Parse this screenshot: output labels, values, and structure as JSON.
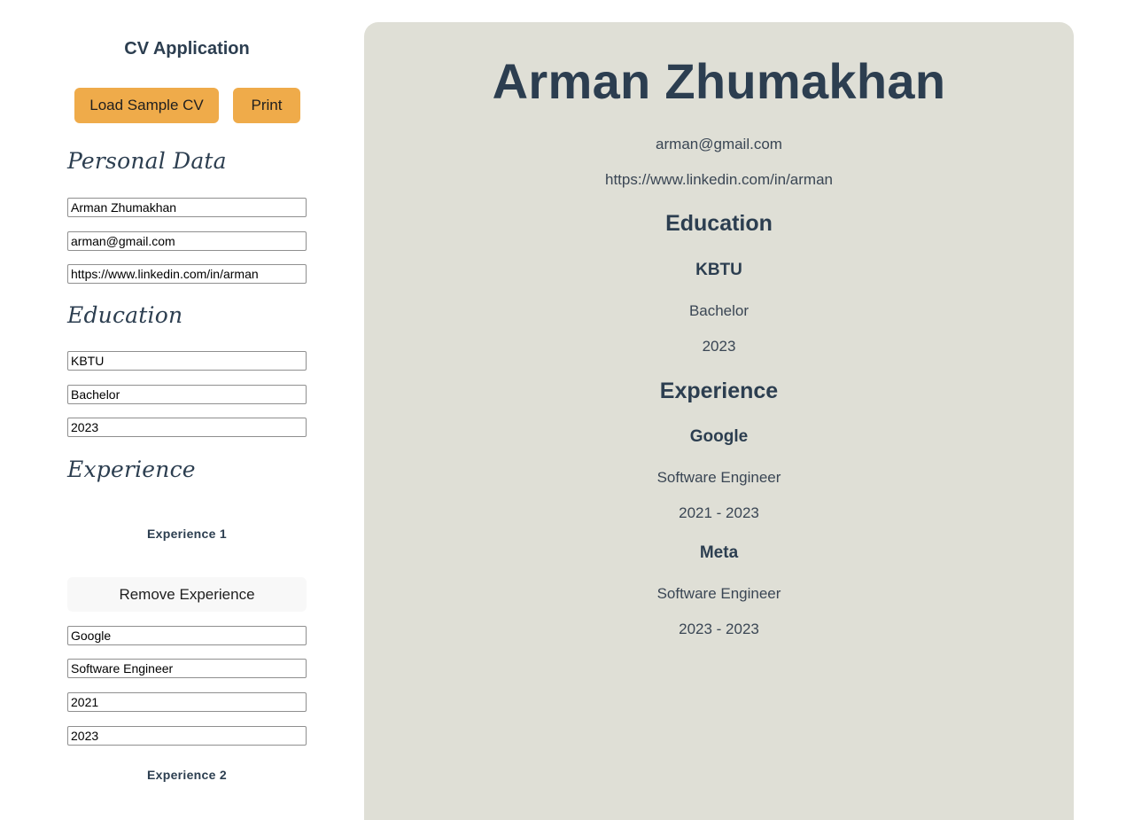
{
  "app": {
    "title": "CV Application",
    "load_sample_label": "Load Sample CV",
    "print_label": "Print"
  },
  "colors": {
    "accent_button": "#efab4a",
    "preview_background": "#dfdfd6",
    "text_dark": "#2c3e50"
  },
  "editor": {
    "personal": {
      "heading": "Personal Data",
      "name": "Arman Zhumakhan",
      "email": "arman@gmail.com",
      "linkedin": "https://www.linkedin.com/in/arman"
    },
    "education": {
      "heading": "Education",
      "school": "KBTU",
      "degree": "Bachelor",
      "year": "2023"
    },
    "experience": {
      "heading": "Experience",
      "remove_label": "Remove Experience",
      "items": [
        {
          "label": "Experience 1",
          "company": "Google",
          "position": "Software Engineer",
          "start": "2021",
          "end": "2023"
        },
        {
          "label": "Experience 2"
        }
      ]
    }
  },
  "preview": {
    "name": "Arman Zhumakhan",
    "email": "arman@gmail.com",
    "linkedin": "https://www.linkedin.com/in/arman",
    "education_heading": "Education",
    "school": "KBTU",
    "degree": "Bachelor",
    "year": "2023",
    "experience_heading": "Experience",
    "experiences": [
      {
        "company": "Google",
        "position": "Software Engineer",
        "dates": "2021 - 2023"
      },
      {
        "company": "Meta",
        "position": "Software Engineer",
        "dates": "2023 - 2023"
      }
    ]
  }
}
